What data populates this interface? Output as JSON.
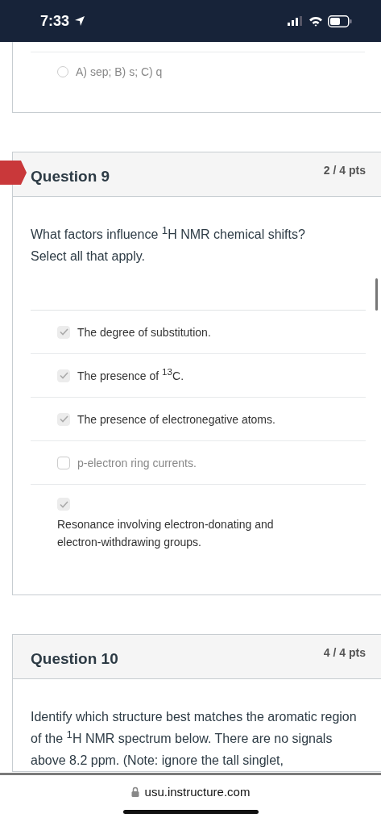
{
  "status_bar": {
    "time": "7:33"
  },
  "previous_question": {
    "options": [
      {
        "label": "A) sep; B) s; C) q",
        "kind": "radio",
        "selected": false
      }
    ]
  },
  "questions": [
    {
      "title": "Question 9",
      "points": "2 / 4 pts",
      "marked": true,
      "text": [
        "What factors influence $^{1}$H NMR chemical shifts?",
        "Select all that apply."
      ],
      "options": [
        {
          "label": "The degree of substitution.",
          "kind": "checkbox",
          "checked": true
        },
        {
          "label": "The presence of $^{13}$C.",
          "kind": "checkbox",
          "checked": true
        },
        {
          "label": "The presence of electronegative atoms.",
          "kind": "checkbox",
          "checked": true
        },
        {
          "label": "p-electron ring currents.",
          "kind": "checkbox",
          "checked": false
        },
        {
          "label": "Resonance involving electron-donating and electron-withdrawing groups.",
          "kind": "stacked",
          "checked": true
        }
      ]
    },
    {
      "title": "Question 10",
      "points": "4 / 4 pts",
      "marked": false,
      "text": [
        "Identify which structure best matches the aromatic region of the $^{1}$H NMR spectrum below. There are no signals above 8.2 ppm. (Note: ignore the tall singlet,"
      ]
    }
  ],
  "browser": {
    "url": "usu.instructure.com"
  }
}
